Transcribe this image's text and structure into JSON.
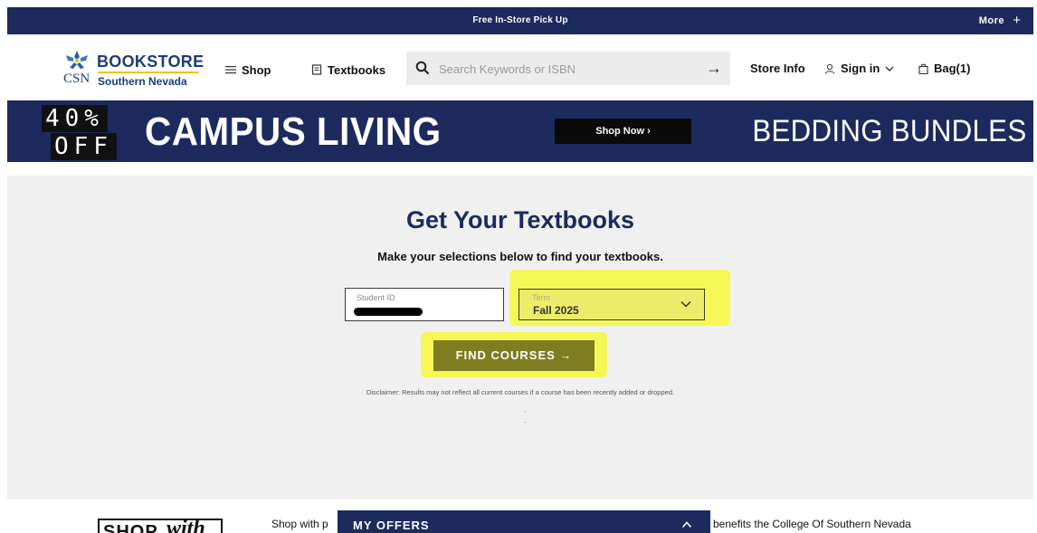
{
  "promo_bar": {
    "message": "Free In-Store Pick Up",
    "more_label": "More",
    "more_icon": "+"
  },
  "header": {
    "logo": {
      "brand": "BOOKSTORE",
      "org": "CSN",
      "campus": "Southern Nevada"
    },
    "nav": {
      "shop": "Shop",
      "textbooks": "Textbooks"
    },
    "search": {
      "placeholder": "Search Keywords or ISBN",
      "submit_icon": "→"
    },
    "utility": {
      "store_info": "Store Info",
      "sign_in": "Sign in",
      "bag": "Bag(1)"
    }
  },
  "banner": {
    "discount_line1": "40%",
    "discount_line2": "OFF",
    "headline": "CAMPUS LIVING",
    "cta": "Shop Now ›",
    "right_text": "BEDDING BUNDLES"
  },
  "textbooks": {
    "title": "Get Your Textbooks",
    "subtitle": "Make your selections below to find your textbooks.",
    "student_id": {
      "label": "Student ID"
    },
    "term": {
      "label": "Term",
      "value": "Fall 2025"
    },
    "find_button": "FIND COURSES →",
    "disclaimer": "Disclaimer: Results may not reflect all current courses if a course has been recently added or dropped.",
    "dots": [
      "-",
      "-"
    ]
  },
  "footer": {
    "shop_word": "SHOP",
    "with_word": "with",
    "text_left": "Shop with p",
    "text_right": "benefits the College Of Southern Nevada",
    "offers_label": "MY OFFERS"
  },
  "colors": {
    "navy": "#1c2a5e",
    "highlight": "#f7f73c",
    "button": "#7e7d1f"
  }
}
